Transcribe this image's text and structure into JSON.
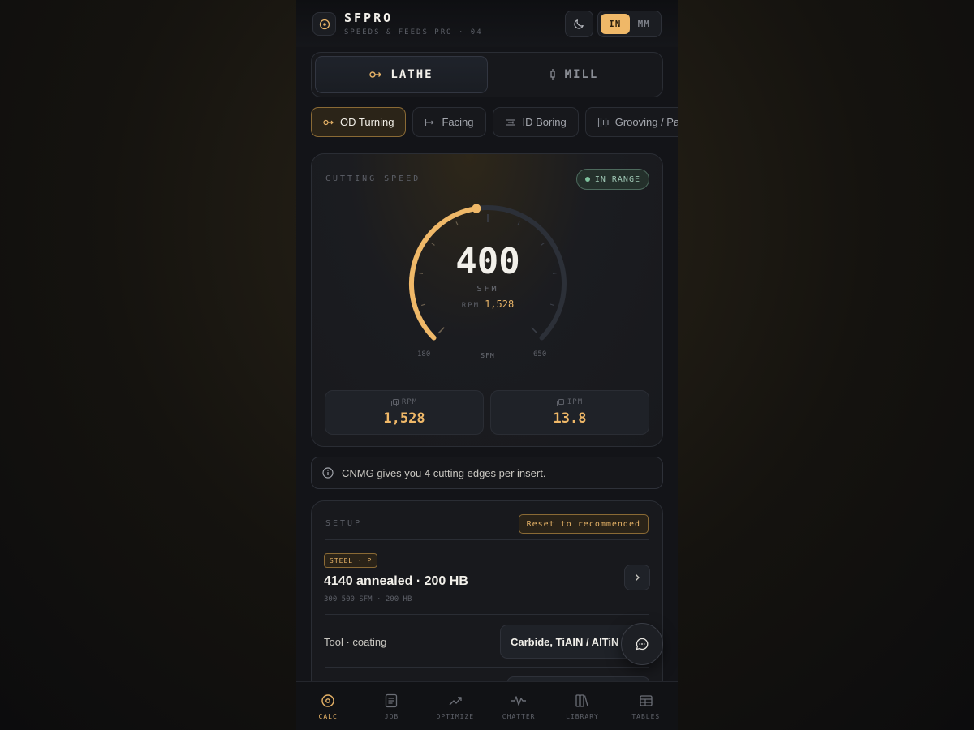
{
  "header": {
    "title": "SFPRO",
    "subtitle": "SPEEDS & FEEDS PRO · 04",
    "units": [
      {
        "label": "IN",
        "active": true
      },
      {
        "label": "MM",
        "active": false
      }
    ]
  },
  "modes": [
    {
      "label": "LATHE",
      "icon": "lathe-icon",
      "active": true
    },
    {
      "label": "MILL",
      "icon": "mill-icon",
      "active": false
    }
  ],
  "operations": [
    {
      "label": "OD Turning",
      "icon": "od-turning-icon",
      "active": true
    },
    {
      "label": "Facing",
      "icon": "facing-icon",
      "active": false
    },
    {
      "label": "ID Boring",
      "icon": "id-boring-icon",
      "active": false
    },
    {
      "label": "Grooving / Pa",
      "icon": "grooving-icon",
      "active": false
    }
  ],
  "gauge": {
    "label": "CUTTING SPEED",
    "status": "IN RANGE",
    "value": "400",
    "value_num": 400,
    "unit": "SFM",
    "rpm_label": "RPM",
    "rpm_value": "1,528",
    "min_label": "180",
    "max_label": "650",
    "min": 180,
    "max": 650,
    "axis_label": "SFM",
    "accent": "#efb868"
  },
  "stats": [
    {
      "label": "RPM",
      "value": "1,528"
    },
    {
      "label": "IPM",
      "value": "13.8"
    }
  ],
  "tip": "CNMG gives you 4 cutting edges per insert.",
  "setup": {
    "label": "SETUP",
    "reset_label": "Reset to recommended",
    "material_chip": "STEEL · P",
    "material_name": "4140 annealed · 200 HB",
    "material_sub": "300–500 SFM · 200 HB",
    "tool_label": "Tool · coating",
    "tool_value": "Carbide, TiAlN / AlTiN"
  },
  "nav": [
    {
      "label": "CALC",
      "icon": "calc-icon",
      "active": true
    },
    {
      "label": "JOB",
      "icon": "job-icon",
      "active": false
    },
    {
      "label": "OPTIMIZE",
      "icon": "optimize-icon",
      "active": false
    },
    {
      "label": "CHATTER",
      "icon": "chatter-icon",
      "active": false
    },
    {
      "label": "LIBRARY",
      "icon": "library-icon",
      "active": false
    },
    {
      "label": "TABLES",
      "icon": "tables-icon",
      "active": false
    }
  ],
  "colors": {
    "accent": "#efb868",
    "ok": "#7fc29e",
    "background": "#131418"
  }
}
